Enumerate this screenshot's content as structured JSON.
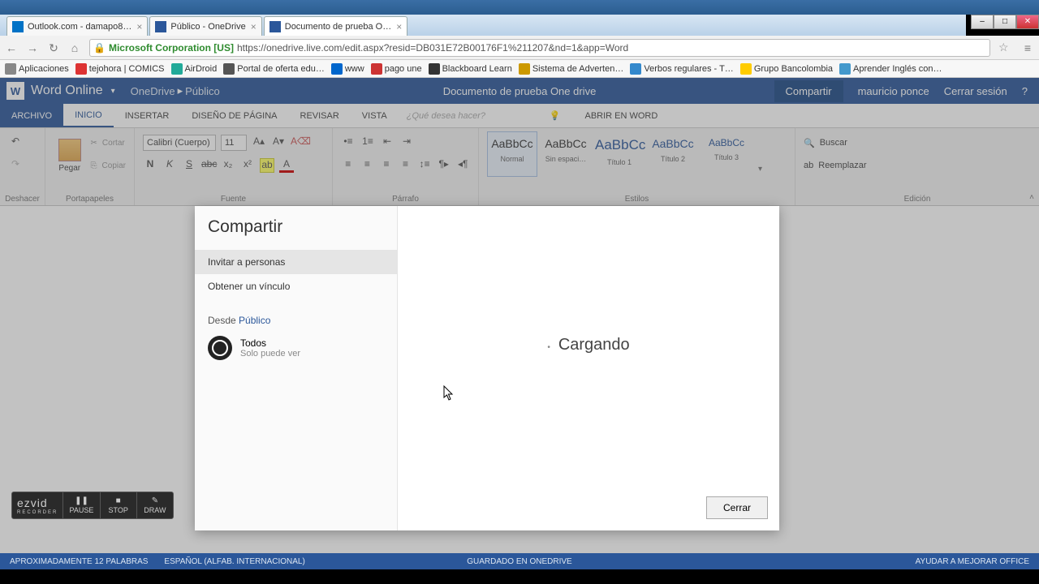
{
  "browser": {
    "tabs": [
      {
        "title": "Outlook.com - damapo8…",
        "favicon": "#0072c6"
      },
      {
        "title": "Público - OneDrive",
        "favicon": "#2b579a"
      },
      {
        "title": "Documento de prueba O…",
        "favicon": "#2b579a",
        "active": true
      }
    ],
    "window_controls": {
      "min": "–",
      "max": "□",
      "close": "✕"
    },
    "nav": {
      "back": "←",
      "forward": "→",
      "reload": "↻",
      "home": "⌂"
    },
    "url_origin": "Microsoft Corporation [US]",
    "url_rest": "https://onedrive.live.com/edit.aspx?resid=DB031E72B00176F1%211207&nd=1&app=Word",
    "bookmarks": [
      {
        "label": "Aplicaciones",
        "color": "#888"
      },
      {
        "label": "tejohora | COMICS",
        "color": "#d33"
      },
      {
        "label": "AirDroid",
        "color": "#2a9"
      },
      {
        "label": "Portal de oferta edu…",
        "color": "#555"
      },
      {
        "label": "www",
        "color": "#06c"
      },
      {
        "label": "pago une",
        "color": "#c33"
      },
      {
        "label": "Blackboard Learn",
        "color": "#333"
      },
      {
        "label": "Sistema de Adverten…",
        "color": "#c90"
      },
      {
        "label": "Verbos regulares - T…",
        "color": "#38c"
      },
      {
        "label": "Grupo Bancolombia",
        "color": "#fc0"
      },
      {
        "label": "Aprender Inglés con…",
        "color": "#49c"
      }
    ]
  },
  "word_header": {
    "logo_letter": "W",
    "app_name": "Word Online",
    "breadcrumb": [
      "OneDrive",
      "Público"
    ],
    "doc_title": "Documento de prueba One drive",
    "share": "Compartir",
    "user": "mauricio ponce",
    "signout": "Cerrar sesión",
    "help": "?"
  },
  "ribbon_tabs": {
    "file": "ARCHIVO",
    "tabs": [
      "INICIO",
      "INSERTAR",
      "DISEÑO DE PÁGINA",
      "REVISAR",
      "VISTA"
    ],
    "active": "INICIO",
    "tellme": "¿Qué desea hacer?",
    "open_word": "ABRIR EN WORD"
  },
  "ribbon": {
    "undo_label": "Deshacer",
    "clipboard": {
      "paste": "Pegar",
      "cut": "Cortar",
      "copy": "Copiar",
      "label": "Portapapeles"
    },
    "font": {
      "name": "Calibri (Cuerpo)",
      "size": "11",
      "label": "Fuente"
    },
    "paragraph": {
      "label": "Párrafo"
    },
    "styles": {
      "label": "Estilos",
      "items": [
        {
          "preview": "AaBbCc",
          "name": "Normal",
          "selected": true
        },
        {
          "preview": "AaBbCc",
          "name": "Sin espaci…"
        },
        {
          "preview": "AaBbCc",
          "name": "Título 1"
        },
        {
          "preview": "AaBbCc",
          "name": "Título 2"
        },
        {
          "preview": "AaBbCc",
          "name": "Título 3"
        }
      ]
    },
    "editing": {
      "find": "Buscar",
      "replace": "Reemplazar",
      "label": "Edición"
    }
  },
  "dialog": {
    "title": "Compartir",
    "items": [
      "Invitar a personas",
      "Obtener un vínculo"
    ],
    "from_prefix": "Desde ",
    "from_link": "Público",
    "perm_title": "Todos",
    "perm_sub": "Solo puede ver",
    "loading": "Cargando",
    "close": "Cerrar"
  },
  "statusbar": {
    "words": "APROXIMADAMENTE 12 PALABRAS",
    "lang": "ESPAÑOL (ALFAB. INTERNACIONAL)",
    "saved": "GUARDADO EN ONEDRIVE",
    "feedback": "AYUDAR A MEJORAR OFFICE"
  },
  "recorder": {
    "brand": "ezvid",
    "brand_sub": "RECORDER",
    "pause": "PAUSE",
    "stop": "STOP",
    "draw": "DRAW"
  }
}
